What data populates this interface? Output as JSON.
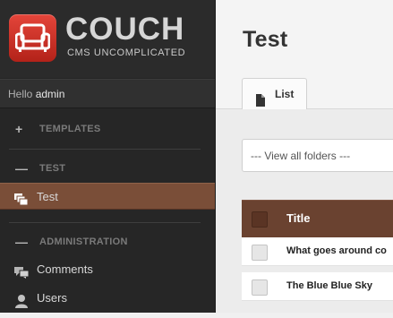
{
  "brand": {
    "name": "COUCH",
    "tagline": "CMS UNCOMPLICATED",
    "badge_color": "#d0392d"
  },
  "greeting": {
    "prefix": "Hello",
    "user": "admin"
  },
  "sidebar": {
    "sections": [
      {
        "symbol": "+",
        "label": "TEMPLATES"
      },
      {
        "symbol": "—",
        "label": "TEST"
      },
      {
        "symbol": "—",
        "label": "ADMINISTRATION"
      }
    ],
    "items": [
      {
        "label": "Test",
        "icon": "stack-icon",
        "active": true
      },
      {
        "label": "Comments",
        "icon": "comments-icon"
      },
      {
        "label": "Users",
        "icon": "user-icon"
      }
    ],
    "active_color": "#7a4e38"
  },
  "main": {
    "title": "Test",
    "tabs": [
      {
        "label": "List",
        "icon": "file-icon"
      }
    ],
    "folder_filter": "--- View all folders ---",
    "table": {
      "header": "Title",
      "rows": [
        {
          "title": "What goes around co"
        },
        {
          "title": "The Blue Blue Sky"
        }
      ]
    }
  }
}
